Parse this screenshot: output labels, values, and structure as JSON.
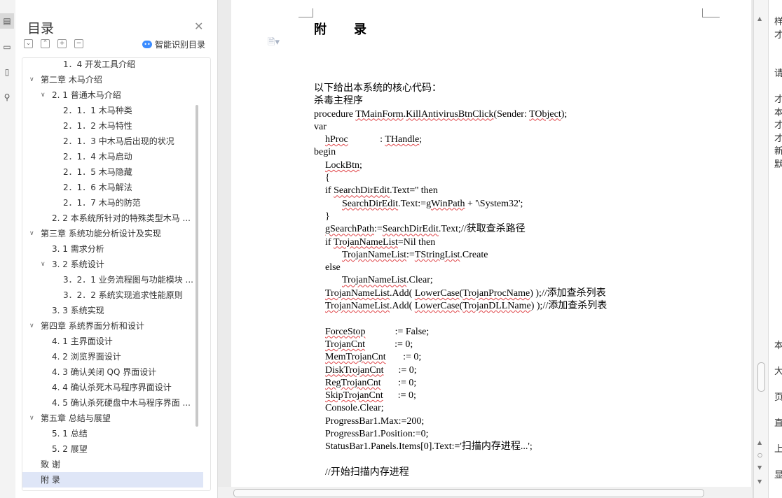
{
  "rail": {
    "icons": [
      "outline-icon",
      "page-icon",
      "bookmark-icon",
      "search-icon"
    ]
  },
  "toc": {
    "title": "目录",
    "smart_label": "智能识别目录",
    "items": [
      {
        "label": "1．4 开发工具介绍",
        "level": 2,
        "arrow": ""
      },
      {
        "label": "第二章  木马介绍",
        "level": 0,
        "arrow": "v"
      },
      {
        "label": "2. 1  普通木马介绍",
        "level": 1,
        "arrow": "v"
      },
      {
        "label": "2．1．1 木马种类",
        "level": 2,
        "arrow": ""
      },
      {
        "label": "2．1．2 木马特性",
        "level": 2,
        "arrow": ""
      },
      {
        "label": "2．1．3 中木马后出现的状况",
        "level": 2,
        "arrow": ""
      },
      {
        "label": "2．1．4 木马启动",
        "level": 2,
        "arrow": ""
      },
      {
        "label": "2．1．5 木马隐藏",
        "level": 2,
        "arrow": ""
      },
      {
        "label": "2．1．6 木马解法",
        "level": 2,
        "arrow": ""
      },
      {
        "label": "2．1．7 木马的防范",
        "level": 2,
        "arrow": ""
      },
      {
        "label": "2. 2 本系统所针对的特殊类型木马 ...",
        "level": 1,
        "arrow": ""
      },
      {
        "label": "第三章  系统功能分析设计及实现",
        "level": 0,
        "arrow": "v"
      },
      {
        "label": "3. 1 需求分析",
        "level": 1,
        "arrow": ""
      },
      {
        "label": "3. 2  系统设计",
        "level": 1,
        "arrow": "v"
      },
      {
        "label": "3．2．1 业务流程图与功能模块 ...",
        "level": 2,
        "arrow": ""
      },
      {
        "label": "3．2．2  系统实现追求性能原则",
        "level": 2,
        "arrow": ""
      },
      {
        "label": "3. 3 系统实现",
        "level": 1,
        "arrow": ""
      },
      {
        "label": "第四章  系统界面分析和设计",
        "level": 0,
        "arrow": "v"
      },
      {
        "label": "4. 1 主界面设计",
        "level": 1,
        "arrow": ""
      },
      {
        "label": "4. 2 浏览界面设计",
        "level": 1,
        "arrow": ""
      },
      {
        "label": "4. 3 确认关闭 QQ 界面设计",
        "level": 1,
        "arrow": ""
      },
      {
        "label": "4. 4 确认杀死木马程序界面设计",
        "level": 1,
        "arrow": ""
      },
      {
        "label": "4. 5 确认杀死硬盘中木马程序界面 ...",
        "level": 1,
        "arrow": ""
      },
      {
        "label": "第五章  总结与展望",
        "level": 0,
        "arrow": "v"
      },
      {
        "label": "5. 1 总结",
        "level": 1,
        "arrow": ""
      },
      {
        "label": "5. 2 展望",
        "level": 1,
        "arrow": ""
      },
      {
        "label": "致      谢",
        "level": 0,
        "arrow": ""
      },
      {
        "label": "附      录",
        "level": 0,
        "arrow": "",
        "selected": true
      }
    ]
  },
  "doc": {
    "heading": "附　　录",
    "lines": [
      {
        "indent": 0,
        "parts": [
          [
            "以下给出本系统的核心代码：",
            0
          ]
        ]
      },
      {
        "indent": 0,
        "parts": [
          [
            "杀毒主程序",
            0
          ]
        ]
      },
      {
        "indent": 0,
        "parts": [
          [
            "procedure ",
            0
          ],
          [
            "TMainForm",
            1
          ],
          [
            ".",
            0
          ],
          [
            "KillAntivirusBtnClick",
            1
          ],
          [
            "(Sender: ",
            0
          ],
          [
            "TObject",
            1
          ],
          [
            ");",
            0
          ]
        ]
      },
      {
        "indent": 0,
        "parts": [
          [
            "var",
            0
          ]
        ]
      },
      {
        "indent": 1,
        "parts": [
          [
            "hProc",
            1
          ],
          [
            "             : ",
            0
          ],
          [
            "THandle",
            1
          ],
          [
            ";",
            0
          ]
        ]
      },
      {
        "indent": 0,
        "parts": [
          [
            "begin",
            0
          ]
        ]
      },
      {
        "indent": 1,
        "parts": [
          [
            "LockBtn",
            1
          ],
          [
            ";",
            0
          ]
        ]
      },
      {
        "indent": 1,
        "parts": [
          [
            "{",
            0
          ]
        ]
      },
      {
        "indent": 1,
        "parts": [
          [
            "if ",
            0
          ],
          [
            "SearchDirEdit",
            1
          ],
          [
            ".Text='' then",
            0
          ]
        ]
      },
      {
        "indent": 2,
        "parts": [
          [
            "SearchDirEdit",
            1
          ],
          [
            ".Text:=",
            0
          ],
          [
            "gWinPath",
            1
          ],
          [
            " + '\\System32';",
            0
          ]
        ]
      },
      {
        "indent": 1,
        "parts": [
          [
            "}",
            0
          ]
        ]
      },
      {
        "indent": 1,
        "parts": [
          [
            "gSearchPath",
            1
          ],
          [
            ":=",
            0
          ],
          [
            "SearchDirEdit",
            1
          ],
          [
            ".Text;//获取查杀路径",
            0
          ]
        ]
      },
      {
        "indent": 1,
        "parts": [
          [
            "if ",
            0
          ],
          [
            "TrojanNameList",
            1
          ],
          [
            "=Nil then",
            0
          ]
        ]
      },
      {
        "indent": 2,
        "parts": [
          [
            "TrojanNameList",
            1
          ],
          [
            ":=",
            0
          ],
          [
            "TStringList",
            1
          ],
          [
            ".Create",
            0
          ]
        ]
      },
      {
        "indent": 1,
        "parts": [
          [
            "else",
            0
          ]
        ]
      },
      {
        "indent": 2,
        "parts": [
          [
            "TrojanNameList",
            1
          ],
          [
            ".Clear;",
            0
          ]
        ]
      },
      {
        "indent": 1,
        "parts": [
          [
            "TrojanNameList",
            1
          ],
          [
            ".Add( ",
            0
          ],
          [
            "LowerCase",
            1
          ],
          [
            "(",
            0
          ],
          [
            "TrojanProcName",
            1
          ],
          [
            ") );//添加查杀列表",
            0
          ]
        ]
      },
      {
        "indent": 1,
        "parts": [
          [
            "TrojanNameList",
            1
          ],
          [
            ".Add( ",
            0
          ],
          [
            "LowerCase",
            1
          ],
          [
            "(",
            0
          ],
          [
            "TrojanDLLName",
            1
          ],
          [
            ") );//添加查杀列表",
            0
          ]
        ]
      },
      {
        "indent": -1,
        "parts": []
      },
      {
        "indent": 1,
        "parts": [
          [
            "ForceStop",
            1
          ],
          [
            "            := False;",
            0
          ]
        ]
      },
      {
        "indent": 1,
        "parts": [
          [
            "TrojanCnt",
            1
          ],
          [
            "            := 0;",
            0
          ]
        ]
      },
      {
        "indent": 1,
        "parts": [
          [
            "MemTrojanCnt",
            1
          ],
          [
            "       := 0;",
            0
          ]
        ]
      },
      {
        "indent": 1,
        "parts": [
          [
            "DiskTrojanCnt",
            1
          ],
          [
            "      := 0;",
            0
          ]
        ]
      },
      {
        "indent": 1,
        "parts": [
          [
            "RegTrojanCnt",
            1
          ],
          [
            "       := 0;",
            0
          ]
        ]
      },
      {
        "indent": 1,
        "parts": [
          [
            "SkipTrojanCnt",
            1
          ],
          [
            "      := 0;",
            0
          ]
        ]
      },
      {
        "indent": 1,
        "parts": [
          [
            "Console.Clear;",
            0
          ]
        ]
      },
      {
        "indent": 1,
        "parts": [
          [
            "ProgressBar1.Max:=200;",
            0
          ]
        ]
      },
      {
        "indent": 1,
        "parts": [
          [
            "ProgressBar1.Position:=0;",
            0
          ]
        ]
      },
      {
        "indent": 1,
        "parts": [
          [
            "StatusBar1.Panels.Items[0].Text:='扫描内存进程...';",
            0
          ]
        ]
      },
      {
        "indent": -1,
        "parts": []
      },
      {
        "indent": 1,
        "parts": [
          [
            "//开始扫描内存进程",
            0
          ]
        ]
      }
    ]
  },
  "right_panel": {
    "chars": [
      "样",
      "才",
      "",
      "",
      "请",
      "",
      "才",
      "本",
      "才",
      "才",
      "新",
      "默",
      "",
      "",
      "",
      "",
      "",
      "",
      "",
      "",
      "",
      "",
      "",
      "",
      "",
      "本",
      "",
      "大",
      "",
      "页",
      "",
      "直",
      "",
      "上",
      "",
      "显"
    ]
  }
}
